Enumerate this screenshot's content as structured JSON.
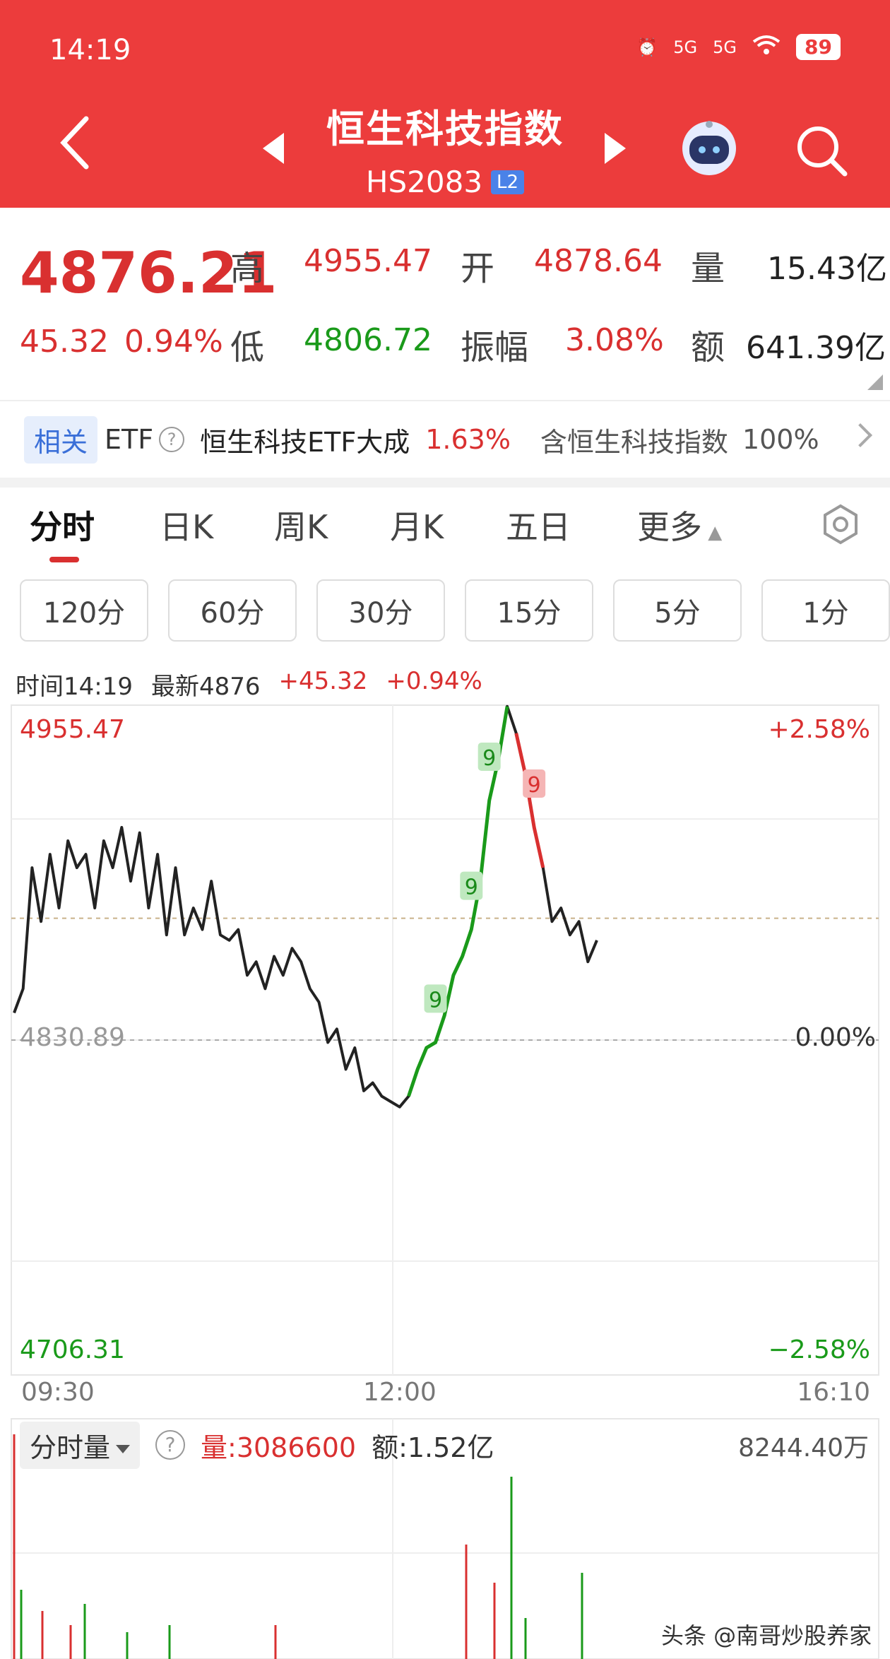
{
  "status": {
    "time": "14:19",
    "signal1": "5G",
    "signal2": "5G",
    "battery": "89"
  },
  "header": {
    "title": "恒生科技指数",
    "code": "HS2083",
    "badge": "L2"
  },
  "quote": {
    "price": "4876.21",
    "change": "45.32",
    "change_pct": "0.94%",
    "high_label": "高",
    "high": "4955.47",
    "open_label": "开",
    "open": "4878.64",
    "volume_label": "量",
    "volume": "15.43亿",
    "low_label": "低",
    "low": "4806.72",
    "amp_label": "振幅",
    "amp": "3.08%",
    "amount_label": "额",
    "amount": "641.39亿"
  },
  "etf": {
    "tag": "相关",
    "label": "ETF",
    "help": "?",
    "name": "恒生科技ETF大成",
    "pct": "1.63%",
    "contain": "含恒生科技指数",
    "weight": "100%"
  },
  "tabs": [
    "分时",
    "日K",
    "周K",
    "月K",
    "五日",
    "更多"
  ],
  "intervals": [
    "120分",
    "60分",
    "30分",
    "15分",
    "5分",
    "1分"
  ],
  "info": {
    "time": "时间14:19",
    "latest": "最新4876",
    "chg": "+45.32",
    "pct": "+0.94%"
  },
  "chart_data": {
    "type": "line",
    "title": "",
    "top_label": "4955.47",
    "top_pct": "+2.58%",
    "base_label": "4830.89",
    "base_pct": "0.00%",
    "bottom_label": "4706.31",
    "bottom_pct": "−2.58%",
    "ylim": [
      4706.31,
      4955.47
    ],
    "x_ticks": [
      "09:30",
      "12:00",
      "16:10"
    ],
    "series": [
      {
        "values": [
          4841,
          4850,
          4895,
          4875,
          4900,
          4880,
          4905,
          4895,
          4900,
          4880,
          4905,
          4895,
          4910,
          4890,
          4908,
          4880,
          4900,
          4870,
          4895,
          4870,
          4880,
          4872,
          4890,
          4870,
          4868,
          4872,
          4855,
          4860,
          4850,
          4862,
          4855,
          4865,
          4860,
          4850,
          4845,
          4830,
          4835,
          4820,
          4828,
          4812,
          4815,
          4810,
          4808,
          4806,
          4810,
          4820,
          4828,
          4830,
          4840,
          4855,
          4862,
          4872,
          4890,
          4920,
          4935,
          4955,
          4945,
          4930,
          4910,
          4895,
          4875,
          4880,
          4870,
          4875,
          4860,
          4868
        ]
      }
    ],
    "signals": [
      "9",
      "9",
      "9",
      "9"
    ]
  },
  "volume": {
    "selector": "分时量",
    "help": "?",
    "liang": "量:3086600",
    "e": "额:1.52亿",
    "max": "8244.40万"
  },
  "watermark": "头条 @南哥炒股养家"
}
